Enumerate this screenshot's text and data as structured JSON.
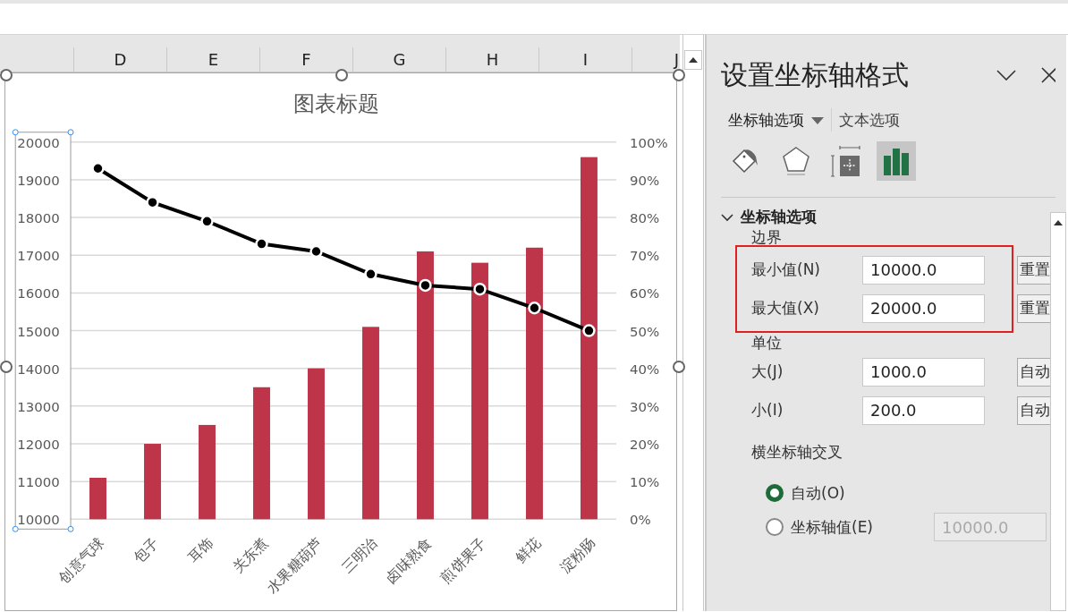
{
  "column_headers": [
    "D",
    "E",
    "F",
    "G",
    "H",
    "I",
    "J"
  ],
  "chart": {
    "chart_data": {
      "type": "bar",
      "title": "图表标题",
      "categories": [
        "创意气球",
        "包子",
        "耳饰",
        "关东煮",
        "水果糖葫芦",
        "三明治",
        "卤味熟食",
        "煎饼果子",
        "鲜花",
        "淀粉肠"
      ],
      "series": [
        {
          "type": "bar",
          "color": "#be3549",
          "values": [
            11100,
            12000,
            12500,
            13500,
            14000,
            15100,
            17100,
            16800,
            17200,
            19600
          ]
        },
        {
          "type": "line",
          "axis": "y2",
          "marker": "circle",
          "color": "#000000",
          "values": [
            0.93,
            0.84,
            0.79,
            0.73,
            0.71,
            0.65,
            0.62,
            0.61,
            0.56,
            0.5
          ]
        }
      ],
      "grid": true,
      "ylim": [
        10000,
        20000
      ],
      "y2lim": [
        0,
        1
      ],
      "yticks": [
        10000,
        11000,
        12000,
        13000,
        14000,
        15000,
        16000,
        17000,
        18000,
        19000,
        20000
      ],
      "y2ticks": [
        {
          "value": 0,
          "label": "0%"
        },
        {
          "value": 0.1,
          "label": "10%"
        },
        {
          "value": 0.2,
          "label": "20%"
        },
        {
          "value": 0.3,
          "label": "30%"
        },
        {
          "value": 0.4,
          "label": "40%"
        },
        {
          "value": 0.5,
          "label": "50%"
        },
        {
          "value": 0.6,
          "label": "60%"
        },
        {
          "value": 0.7,
          "label": "70%"
        },
        {
          "value": 0.8,
          "label": "80%"
        },
        {
          "value": 0.9,
          "label": "90%"
        },
        {
          "value": 1,
          "label": "100%"
        }
      ]
    }
  },
  "panel": {
    "title": "设置坐标轴格式",
    "tabs": [
      {
        "label": "坐标轴选项",
        "selected": true,
        "dropdown": true
      },
      {
        "label": "文本选项",
        "selected": false,
        "dropdown": false
      }
    ],
    "icon_tabs": [
      {
        "kind": "fill",
        "selected": false
      },
      {
        "kind": "effects",
        "selected": false
      },
      {
        "kind": "size",
        "selected": false
      },
      {
        "kind": "axis",
        "selected": true
      }
    ],
    "section": {
      "title": "坐标轴选项",
      "expanded": true,
      "groups": [
        {
          "title": "边界",
          "highlighted": true,
          "rows": [
            {
              "label": "最小值(N)",
              "value": "10000.0",
              "button": "重置"
            },
            {
              "label": "最大值(X)",
              "value": "20000.0",
              "button": "重置"
            }
          ]
        },
        {
          "title": "单位",
          "highlighted": false,
          "rows": [
            {
              "label": "大(J)",
              "value": "1000.0",
              "button": "自动"
            },
            {
              "label": "小(I)",
              "value": "200.0",
              "button": "自动"
            }
          ]
        }
      ],
      "crossing": {
        "title": "横坐标轴交叉",
        "options": [
          {
            "label": "自动(O)",
            "selected": true
          },
          {
            "label": "坐标轴值(E)",
            "selected": false,
            "value": "10000.0",
            "disabled": true
          }
        ]
      }
    }
  }
}
